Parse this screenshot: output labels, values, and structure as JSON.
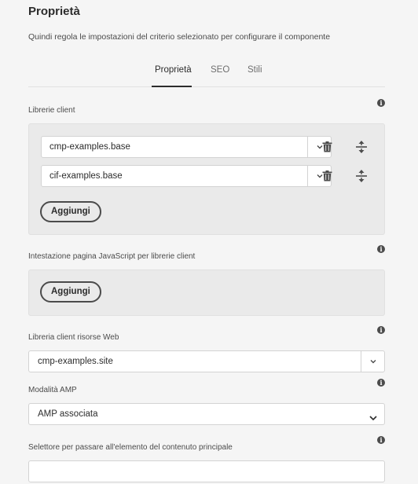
{
  "header": {
    "title": "Proprietà",
    "subtitle": "Quindi regola le impostazioni del criterio selezionato per configurare il componente"
  },
  "tabs": [
    {
      "label": "Proprietà",
      "active": true
    },
    {
      "label": "SEO",
      "active": false
    },
    {
      "label": "Stili",
      "active": false
    }
  ],
  "client_libraries": {
    "label": "Librerie client",
    "items": [
      {
        "value": "cmp-examples.base"
      },
      {
        "value": "cif-examples.base"
      }
    ],
    "add_label": "Aggiungi"
  },
  "js_head_libraries": {
    "label": "Intestazione pagina JavaScript per librerie client",
    "add_label": "Aggiungi"
  },
  "web_resources_library": {
    "label": "Libreria client risorse Web",
    "value": "cmp-examples.site"
  },
  "amp_mode": {
    "label": "Modalità AMP",
    "value": "AMP associata"
  },
  "skip_selector": {
    "label": "Selettore per passare all'elemento del contenuto principale",
    "value": ""
  },
  "icons": {
    "info": "info-icon",
    "chevron": "chevron-down-icon",
    "delete": "trash-icon",
    "reorder": "move-vertical-icon"
  },
  "colors": {
    "background": "#f5f5f5",
    "panel": "#eaeaea",
    "text": "#4b4b4b",
    "active_tab": "#2c2c2c"
  }
}
